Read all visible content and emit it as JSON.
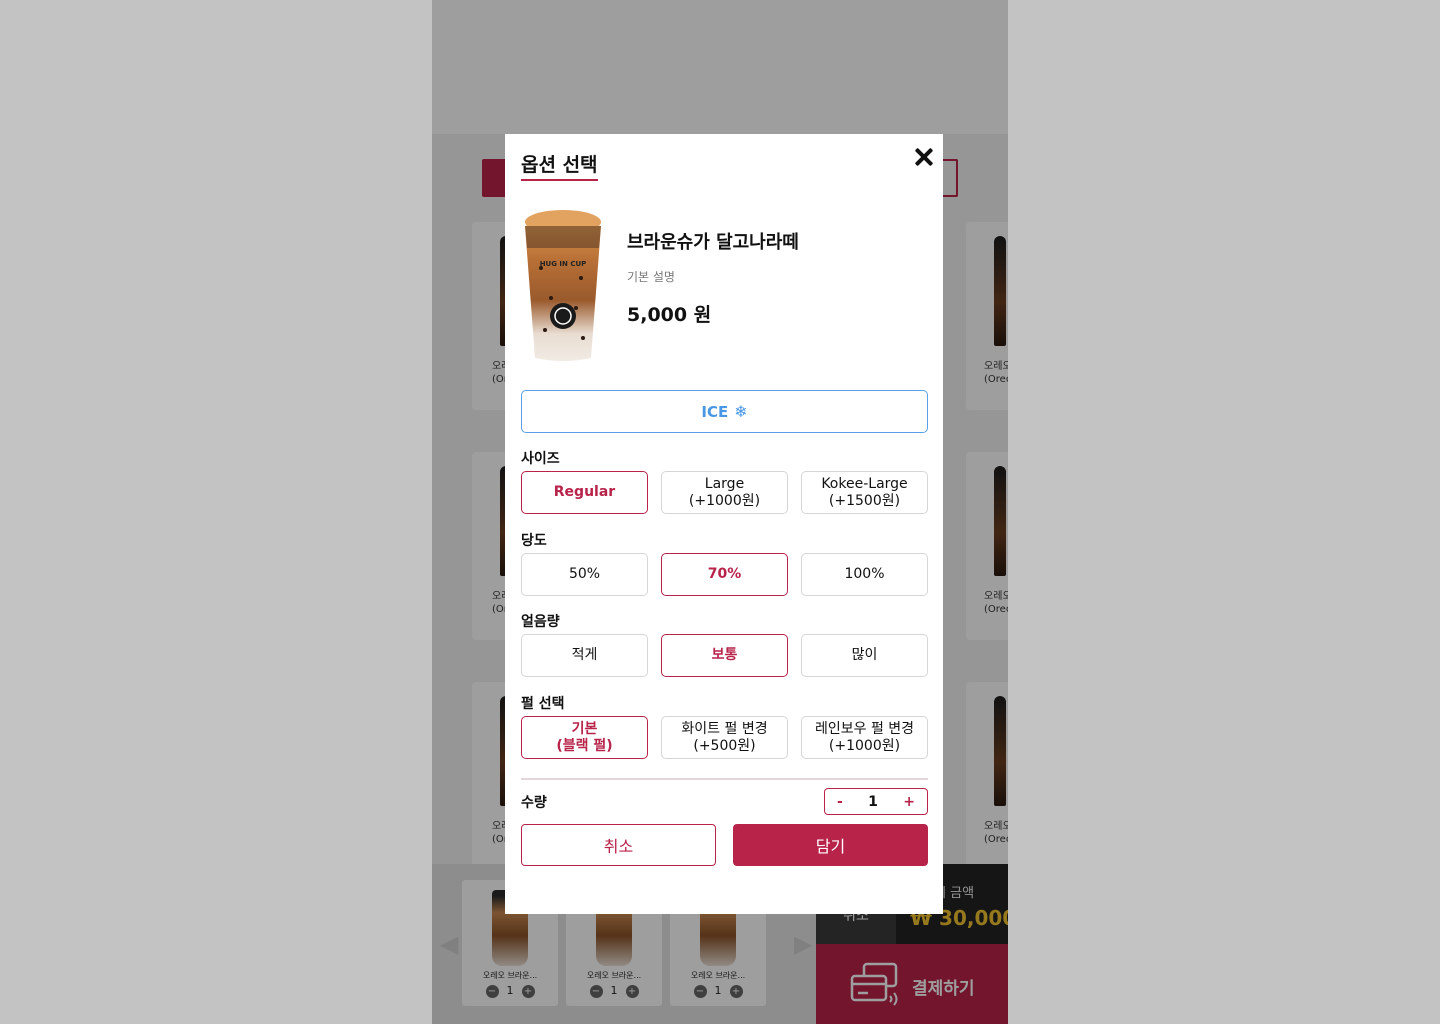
{
  "modal": {
    "title": "옵션 선택",
    "product": {
      "name": "브라운슈가 달고나라떼",
      "description": "기본 설명",
      "price": "5,000 원",
      "cup_text": "HUG IN CUP"
    },
    "temperature": {
      "label": "ICE",
      "icon": "snowflake-icon"
    },
    "size": {
      "label": "사이즈",
      "options": [
        "Regular",
        "Large\n(+1000원)",
        "Kokee-Large\n(+1500원)"
      ],
      "selected": 0
    },
    "sweetness": {
      "label": "당도",
      "options": [
        "50%",
        "70%",
        "100%"
      ],
      "selected": 1
    },
    "ice": {
      "label": "얼음량",
      "options": [
        "적게",
        "보통",
        "많이"
      ],
      "selected": 1
    },
    "pearl": {
      "label": "펄 선택",
      "options": [
        "기본\n(블랙 펄)",
        "화이트 펄 변경\n(+500원)",
        "레인보우 펄 변경\n(+1000원)"
      ],
      "selected": 0
    },
    "quantity": {
      "label": "수량",
      "minus": "-",
      "value": "1",
      "plus": "+"
    },
    "cancel_label": "취소",
    "add_label": "담기"
  },
  "background": {
    "menu_name_partial": [
      "오레",
      "(Ore"
    ],
    "menu_name_partial_right": [
      "오레오",
      "(Oreo"
    ],
    "cart_items": [
      {
        "name": "오레오 브라운...",
        "qty": "1"
      },
      {
        "name": "오레오 브라운...",
        "qty": "1"
      },
      {
        "name": "오레오 브라운...",
        "qty": "1"
      }
    ],
    "cart_cancel": "취소",
    "total_label": "총 결제 금액",
    "total_amount": "₩ 30,000",
    "pay_label": "결제하기"
  },
  "colors": {
    "accent": "#b8234a",
    "ice_blue": "#4a97e6",
    "total_yellow": "#f2c230"
  }
}
